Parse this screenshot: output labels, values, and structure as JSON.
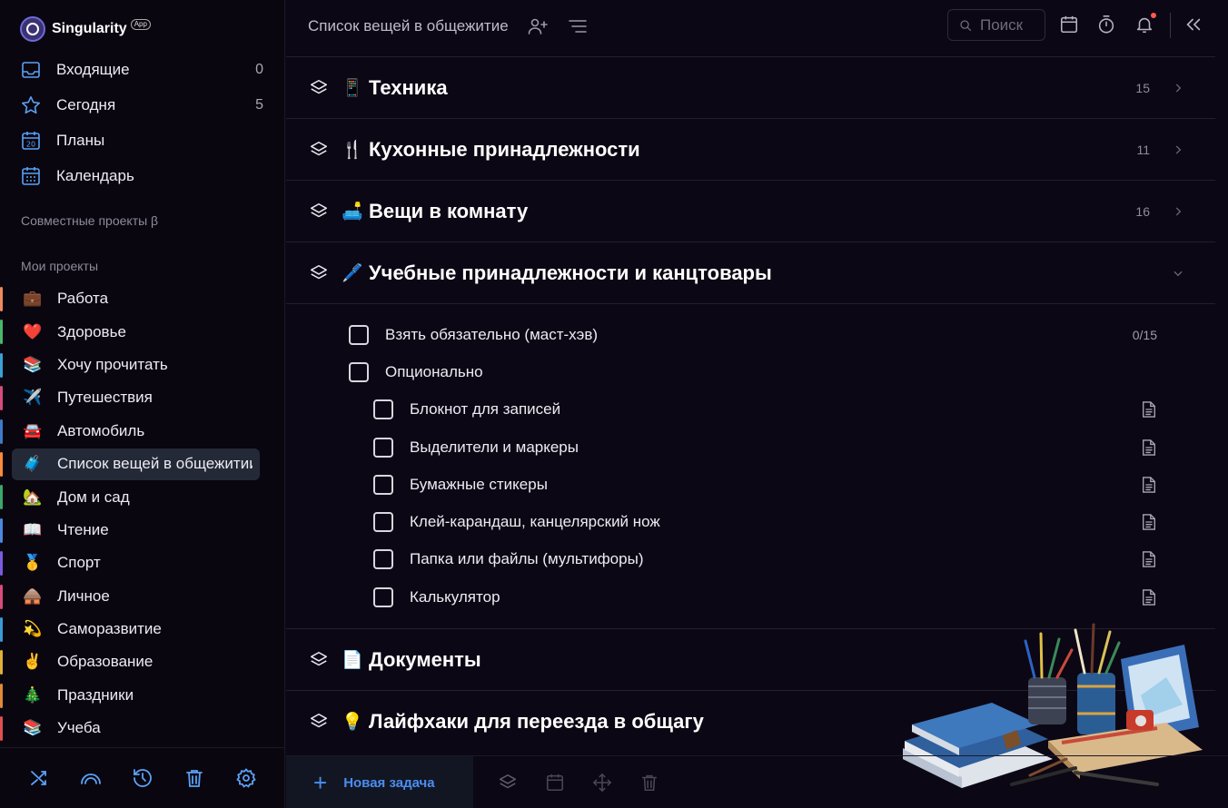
{
  "app": {
    "name": "Singularity",
    "badge": "App"
  },
  "nav": [
    {
      "label": "Входящие",
      "count": "0",
      "icon": "inbox-icon"
    },
    {
      "label": "Сегодня",
      "count": "5",
      "icon": "star-icon"
    },
    {
      "label": "Планы",
      "count": "",
      "icon": "calendar-20-icon"
    },
    {
      "label": "Календарь",
      "count": "",
      "icon": "calendar-grid-icon"
    }
  ],
  "sections": {
    "shared": "Совместные проекты β",
    "mine": "Мои проекты"
  },
  "projects": [
    {
      "emoji": "💼",
      "label": "Работа",
      "color": "#f08a5d"
    },
    {
      "emoji": "❤️",
      "label": "Здоровье",
      "color": "#49b86a"
    },
    {
      "emoji": "📚",
      "label": "Хочу прочитать",
      "color": "#3aa1d8"
    },
    {
      "emoji": "✈️",
      "label": "Путешествия",
      "color": "#d94b7b"
    },
    {
      "emoji": "🚘",
      "label": "Автомобиль",
      "color": "#3f7cc8"
    },
    {
      "emoji": "🧳",
      "label": "Список вещей в общежитии",
      "color": "#ff8a3c"
    },
    {
      "emoji": "🏡",
      "label": "Дом и сад",
      "color": "#3aa86a"
    },
    {
      "emoji": "📖",
      "label": "Чтение",
      "color": "#4a8ae0"
    },
    {
      "emoji": "🥇",
      "label": "Спорт",
      "color": "#7a5be0"
    },
    {
      "emoji": "🛖",
      "label": "Личное",
      "color": "#d94b7b"
    },
    {
      "emoji": "💫",
      "label": "Саморазвитие",
      "color": "#3a9ad9"
    },
    {
      "emoji": "✌️",
      "label": "Образование",
      "color": "#e0b03a"
    },
    {
      "emoji": "🎄",
      "label": "Праздники",
      "color": "#e08a3a"
    },
    {
      "emoji": "📚",
      "label": "Учеба",
      "color": "#e05050"
    }
  ],
  "active_project": "Список вещей в общежитии",
  "header": {
    "title": "Список вещей в общежитие",
    "search_placeholder": "Поиск"
  },
  "groups_before": [
    {
      "emoji": "📱",
      "title": "Техника",
      "count": "15"
    },
    {
      "emoji": "🍴",
      "title": "Кухонные принадлежности",
      "count": "11"
    },
    {
      "emoji": "🛋️",
      "title": "Вещи в комнату",
      "count": "16"
    },
    {
      "emoji": "🖊️",
      "title": "Учебные принадлежности и канцтовары",
      "count": ""
    }
  ],
  "expanded_tasks": [
    {
      "label": "Взять обязательно (маст-хэв)",
      "count": "0/15",
      "level": 0,
      "note": false
    },
    {
      "label": "Опционально",
      "count": "",
      "level": 0,
      "note": false
    },
    {
      "label": "Блокнот для записей",
      "count": "",
      "level": 1,
      "note": true
    },
    {
      "label": "Выделители и маркеры",
      "count": "",
      "level": 1,
      "note": true
    },
    {
      "label": "Бумажные стикеры",
      "count": "",
      "level": 1,
      "note": true
    },
    {
      "label": "Клей-карандаш, канцелярский нож",
      "count": "",
      "level": 1,
      "note": true
    },
    {
      "label": "Папка или файлы (мультифоры)",
      "count": "",
      "level": 1,
      "note": true
    },
    {
      "label": "Калькулятор",
      "count": "",
      "level": 1,
      "note": true
    }
  ],
  "groups_after": [
    {
      "emoji": "📄",
      "title": "Документы",
      "count": ""
    },
    {
      "emoji": "💡",
      "title": "Лайфхаки для переезда в общагу",
      "count": ""
    }
  ],
  "bottom": {
    "new_task": "Новая задача"
  },
  "colors": {
    "accent": "#4b8df0",
    "icon_blue": "#5aa2f5",
    "background": "#0c0714"
  }
}
